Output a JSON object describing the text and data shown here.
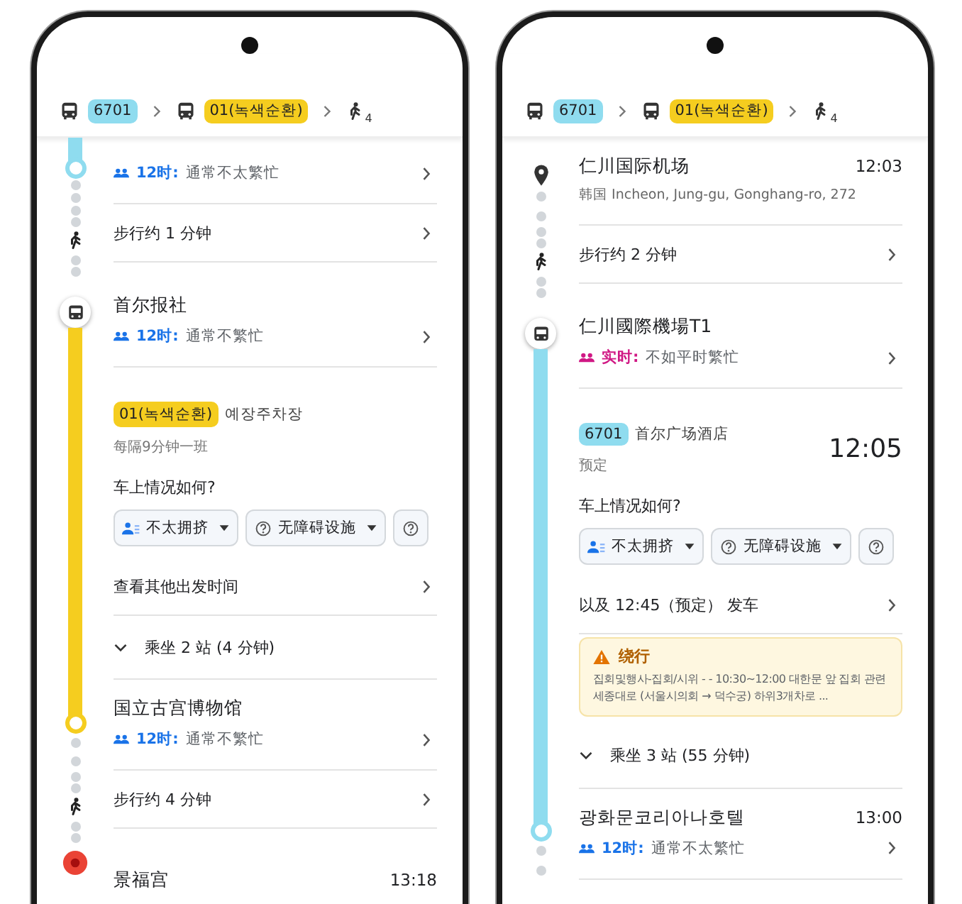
{
  "phones": [
    {
      "route": [
        {
          "kind": "bus",
          "label": "6701",
          "color": "#8fdcef"
        },
        {
          "kind": "bus",
          "label": "01(녹색순환)",
          "color": "#f5cd1f"
        },
        {
          "kind": "walk",
          "label": "4"
        }
      ],
      "rows": [
        {
          "kind": "stop",
          "rail": [
            {
              "kind": "bar",
              "color": "#8fdcef"
            },
            {
              "kind": "ring",
              "color": "#8fdcef"
            },
            {
              "kind": "dots"
            }
          ],
          "crowd": {
            "label": "12时:",
            "text": "通常不太繁忙",
            "live": false
          }
        },
        {
          "kind": "walk",
          "rail": [
            {
              "kind": "dots"
            },
            {
              "kind": "walk"
            },
            {
              "kind": "dots"
            }
          ],
          "text": "步行约 1 分钟"
        },
        {
          "kind": "stop",
          "rail": [
            {
              "kind": "bus"
            },
            {
              "kind": "bar",
              "color": "#f5cd1f"
            }
          ],
          "name": "首尔报社",
          "crowd": {
            "label": "12时:",
            "text": "通常不繁忙",
            "live": false
          }
        },
        {
          "kind": "departure",
          "rail": [
            {
              "kind": "bar",
              "color": "#f5cd1f"
            }
          ],
          "chip": {
            "label": "01(녹색순환)",
            "color": "#f5cd1f"
          },
          "destination": "예장주차장",
          "note": "每隔9分钟一班",
          "question": "车上情况如何?",
          "options": [
            {
              "kind": "people",
              "label": "不太拥挤"
            },
            {
              "kind": "help",
              "label": "无障碍设施"
            },
            {
              "kind": "help"
            }
          ]
        },
        {
          "kind": "link",
          "rail": [
            {
              "kind": "bar",
              "color": "#f5cd1f"
            }
          ],
          "text": "查看其他出发时间"
        },
        {
          "kind": "ride",
          "rail": [
            {
              "kind": "bar",
              "color": "#f5cd1f"
            }
          ],
          "text": "乘坐 2 站 (4 分钟)"
        },
        {
          "kind": "stop",
          "rail": [
            {
              "kind": "bar",
              "color": "#f5cd1f"
            },
            {
              "kind": "ring",
              "color": "#f5cd1f"
            },
            {
              "kind": "dots"
            }
          ],
          "name": "国立古宫博物馆",
          "crowd": {
            "label": "12时:",
            "text": "通常不繁忙",
            "live": false
          }
        },
        {
          "kind": "walk",
          "rail": [
            {
              "kind": "dots"
            },
            {
              "kind": "walk"
            },
            {
              "kind": "dots"
            }
          ],
          "text": "步行约 4 分钟"
        },
        {
          "kind": "end",
          "rail": [
            {
              "kind": "dest"
            }
          ],
          "name": "景福宫",
          "time": "13:18"
        }
      ]
    },
    {
      "route": [
        {
          "kind": "bus",
          "label": "6701",
          "color": "#8fdcef"
        },
        {
          "kind": "bus",
          "label": "01(녹색순환)",
          "color": "#f5cd1f"
        },
        {
          "kind": "walk",
          "label": "4"
        }
      ],
      "rows": [
        {
          "kind": "stop",
          "rail": [
            {
              "kind": "pin"
            },
            {
              "kind": "dots"
            }
          ],
          "name": "仁川国际机场",
          "time": "12:03",
          "address": "韩国 Incheon, Jung-gu, Gonghang-ro, 272"
        },
        {
          "kind": "walk",
          "rail": [
            {
              "kind": "dots"
            },
            {
              "kind": "walk"
            },
            {
              "kind": "dots"
            }
          ],
          "text": "步行约 2 分钟"
        },
        {
          "kind": "stop",
          "rail": [
            {
              "kind": "bus"
            },
            {
              "kind": "bar",
              "color": "#8fdcef"
            }
          ],
          "name": "仁川國際機場T1",
          "crowd": {
            "label": "实时:",
            "text": "不如平时繁忙",
            "live": true
          }
        },
        {
          "kind": "departure",
          "rail": [
            {
              "kind": "bar",
              "color": "#8fdcef"
            }
          ],
          "chip": {
            "label": "6701",
            "color": "#8fdcef"
          },
          "destination": "首尔广场酒店",
          "note": "预定",
          "time": "12:05",
          "question": "车上情况如何?",
          "options": [
            {
              "kind": "people",
              "label": "不太拥挤"
            },
            {
              "kind": "help",
              "label": "无障碍设施"
            },
            {
              "kind": "help"
            }
          ]
        },
        {
          "kind": "link",
          "rail": [
            {
              "kind": "bar",
              "color": "#8fdcef"
            }
          ],
          "text": "以及 12:45（预定） 发车"
        },
        {
          "kind": "alert",
          "rail": [
            {
              "kind": "bar",
              "color": "#8fdcef"
            }
          ],
          "title": "绕行",
          "text": "집회및행사-집회/시위 - - 10:30~12:00 대한문 앞 집회 관련 세종대로 (서울시의회 → 덕수궁) 하위3개차로 ..."
        },
        {
          "kind": "ride",
          "rail": [
            {
              "kind": "bar",
              "color": "#8fdcef"
            }
          ],
          "text": "乘坐 3 站 (55 分钟)"
        },
        {
          "kind": "stop",
          "rail": [
            {
              "kind": "bar",
              "color": "#8fdcef"
            },
            {
              "kind": "ring",
              "color": "#8fdcef"
            },
            {
              "kind": "dots"
            }
          ],
          "name": "광화문코리아나호텔",
          "time": "13:00",
          "crowd": {
            "label": "12时:",
            "text": "通常不太繁忙",
            "live": false
          }
        }
      ]
    }
  ]
}
